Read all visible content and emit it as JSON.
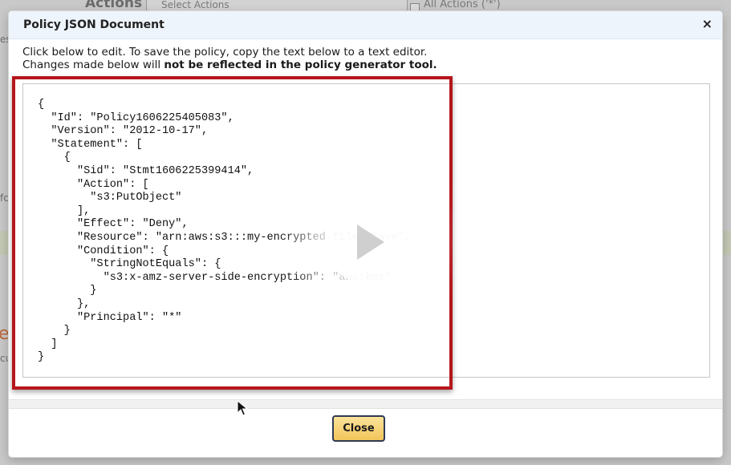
{
  "background": {
    "actions_label": "Actions",
    "select_placeholder": "Select Actions",
    "all_actions_label": "All Actions ('*')",
    "edge_letters": [
      "es",
      "fc",
      "e",
      "cu"
    ]
  },
  "modal": {
    "title": "Policy JSON Document",
    "close_icon": "×",
    "instructions": {
      "line1": "Click below to edit. To save the policy, copy the text below to a text editor.",
      "line2_prefix": "Changes made below will ",
      "line2_bold": "not be reflected in the policy generator tool."
    },
    "policy_json": "{\n  \"Id\": \"Policy1606225405083\",\n  \"Version\": \"2012-10-17\",\n  \"Statement\": [\n    {\n      \"Sid\": \"Stmt1606225399414\",\n      \"Action\": [\n        \"s3:PutObject\"\n      ],\n      \"Effect\": \"Deny\",\n      \"Resource\": \"arn:aws:s3:::my-encrypted-files-fave\",\n      \"Condition\": {\n        \"StringNotEquals\": {\n          \"s3:x-amz-server-side-encryption\": \"aws:kms\"\n        }\n      },\n      \"Principal\": \"*\"\n    }\n  ]\n}",
    "close_button_label": "Close"
  },
  "icons": {
    "play": "play-icon",
    "cursor": "mouse-cursor-icon"
  },
  "colors": {
    "highlight": "#b5161c",
    "close_button": "#f2c45a",
    "header_bg": "#eef4fb"
  }
}
